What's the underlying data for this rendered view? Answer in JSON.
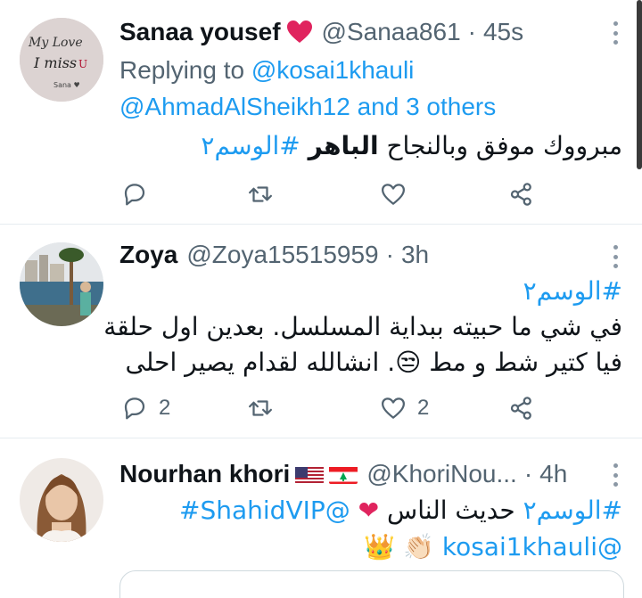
{
  "tweets": [
    {
      "name": "Sanaa yousef",
      "handle": "@Sanaa861",
      "time": "45s",
      "avatar_text": {
        "line1": "My Love",
        "line2": "I miss U",
        "line3": "Sana ♥"
      },
      "replying_prefix": "Replying to",
      "replying_to_line1": "@kosai1khauli",
      "replying_to_line2": "@AhmadAlSheikh12 and 3 others",
      "text_plain": "مبرووك موفق وبالنجاح ",
      "text_bold": "الباهر",
      "text_hashtag": " #الوسم٢",
      "reply_count": "",
      "like_count": ""
    },
    {
      "name": "Zoya",
      "handle": "@Zoya15515959",
      "time": "3h",
      "hashtag": "#الوسم٢",
      "line1": "في شي ما حبيته ببداية المسلسل. بعدين اول حلقة",
      "line2": "فيا كتير شط و مط 😒. انشالله لقدام يصير احلى",
      "reply_count": "2",
      "like_count": "2"
    },
    {
      "name": "Nourhan khori",
      "handle": "@KhoriNou...",
      "time": "4h",
      "line1_hashtag": "#الوسم٢",
      "line1_text": " حديث الناس",
      "line1_mention": "@ShahidVIP#",
      "line2_mention": "@kosai1khauli",
      "line2_emoji": "👏🏻 👑"
    }
  ],
  "icons": [
    "heart-icon",
    "reply-icon",
    "retweet-icon",
    "like-icon",
    "share-icon",
    "more-icon",
    "usa-flag-icon",
    "lebanon-flag-icon"
  ],
  "colors": {
    "link": "#1d9bf0",
    "secondary": "#536471",
    "heart": "#e0245e",
    "border": "#e6ecf0"
  }
}
